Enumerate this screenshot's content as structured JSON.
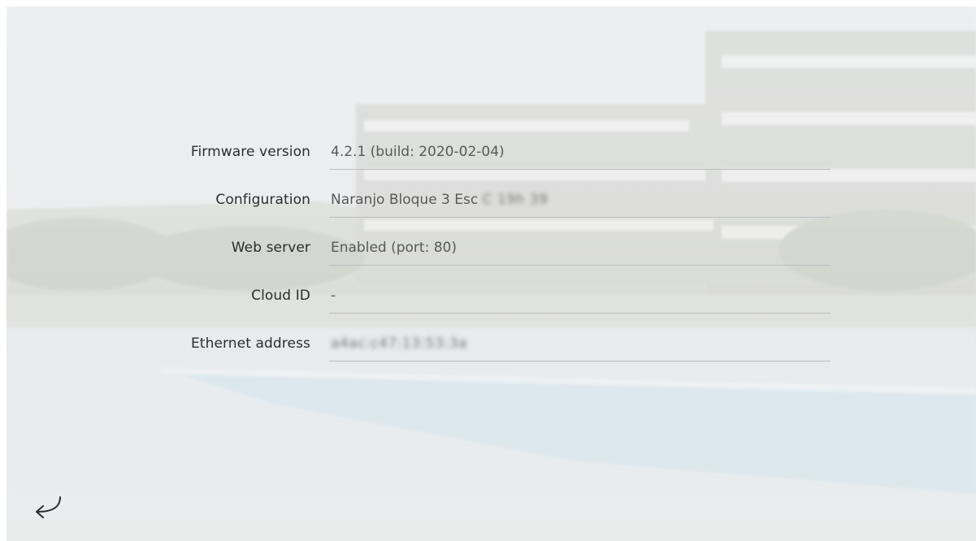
{
  "info": {
    "rows": [
      {
        "label": "Firmware version",
        "value": "4.2.1  (build: 2020-02-04)"
      },
      {
        "label": "Configuration",
        "value": "Naranjo Bloque 3 Esc ",
        "redacted": "C 19h 39"
      },
      {
        "label": "Web server",
        "value": "Enabled (port: 80)"
      },
      {
        "label": "Cloud ID",
        "value": "-"
      },
      {
        "label": "Ethernet address",
        "value": "",
        "redacted": "a4ac:c47:13:53:3a"
      }
    ]
  },
  "icons": {
    "back": "return-arrow-icon"
  }
}
